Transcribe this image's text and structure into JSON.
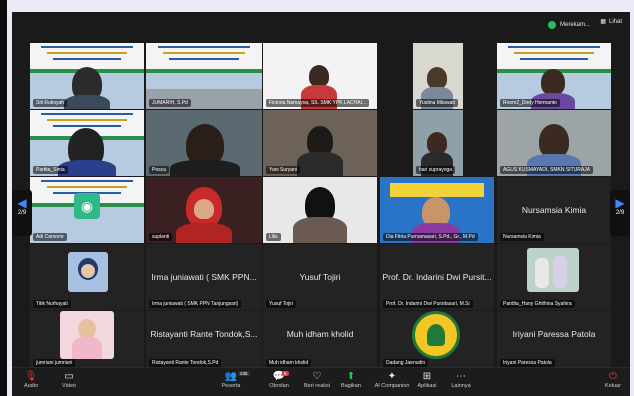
{
  "recording": {
    "label": "Merekam...",
    "color": "#1fbf5b"
  },
  "view": {
    "label": "Lihat"
  },
  "pagination": {
    "left": "2/9",
    "right": "2/9"
  },
  "tiles": [
    {
      "name": "Siti Rukoyah"
    },
    {
      "name": "JUMARIH, S.Pd"
    },
    {
      "name": "Fictoria Namayoa, SS. SMK YPK LACHAI..."
    },
    {
      "name": "Yustina Milawati"
    },
    {
      "name": "Room2_Dody Hermanto"
    },
    {
      "name": "Partita_Sinta"
    },
    {
      "name": "Pesca"
    },
    {
      "name": "Yani Suryani"
    },
    {
      "name": "hari suprayoga"
    },
    {
      "name": "AGUS KUSMAYADI, SMKN SITURAJA"
    },
    {
      "name": "Adi Carsono"
    },
    {
      "name": "suplanti"
    },
    {
      "name": "Lilis"
    },
    {
      "name": "Dia Fitria Purnamasari, S.Pd., Gr., M.Pd"
    },
    {
      "name": "Nursamsia Kimia",
      "big": "Nursamsia Kimia"
    },
    {
      "name": "Titik Nurhayati"
    },
    {
      "name": "Irma juniawati ( SMK PPN Tanjungsari)",
      "big": "Irma juniawati ( SMK PPN..."
    },
    {
      "name": "Yusuf Tojiri",
      "big": "Yusuf Tojiri"
    },
    {
      "name": "Prof. Dr. Indarini Dwi Pursitasari, M.Si",
      "big": "Prof. Dr. Indarini Dwi Pursit..."
    },
    {
      "name": "Pardita_Hany Ghithina Syahira"
    },
    {
      "name": "jumriani jumriani"
    },
    {
      "name": "Ristayanti Rante Tondok,S.Pd",
      "big": "Ristayanti Rante Tondok,S..."
    },
    {
      "name": "Muh idham kholid",
      "big": "Muh idham kholid"
    },
    {
      "name": "Dadang Jaenudin"
    },
    {
      "name": "Iriyani Paressa Patola",
      "big": "Iriyani Paressa Patola"
    }
  ],
  "toolbar": {
    "audio": "Audio",
    "video": "Video",
    "participants": "Peserta",
    "participants_count": "235",
    "chat": "Obrolan",
    "chat_badge": "5",
    "reactions": "Beri reaksi",
    "share": "Bagikan",
    "ai": "AI Companion",
    "apps": "Aplikasi",
    "more": "Lainnya",
    "leave": "Keluar"
  }
}
